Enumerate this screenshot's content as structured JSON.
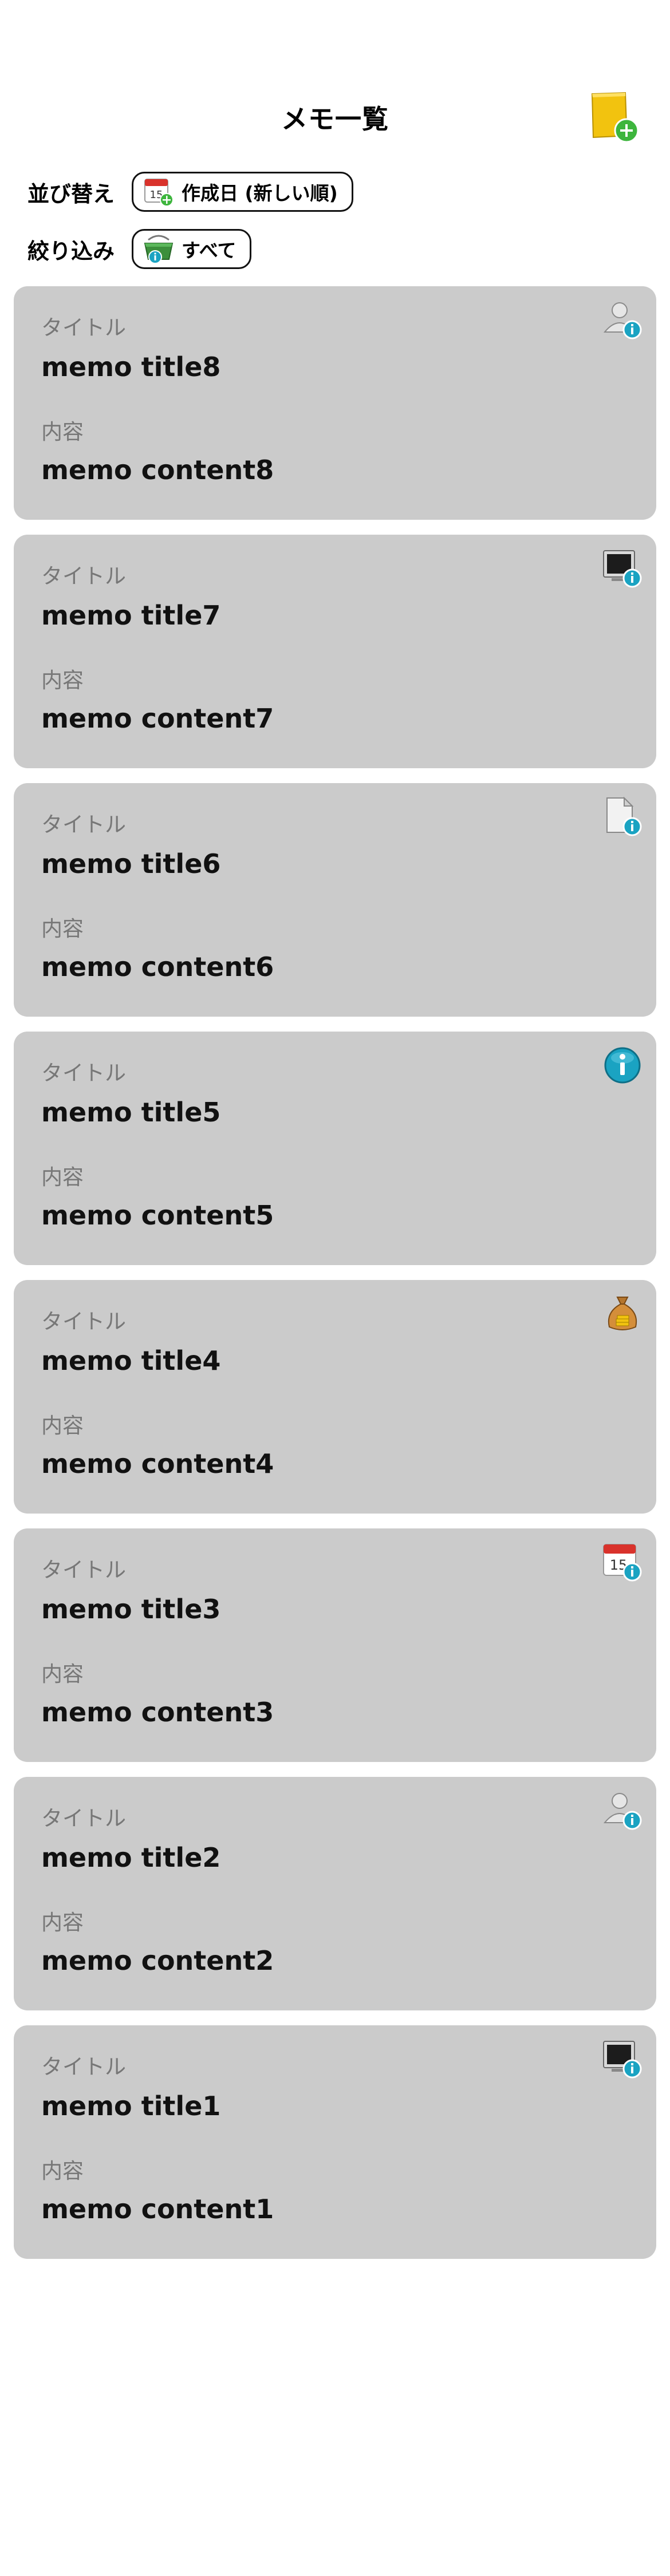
{
  "header": {
    "title": "メモ一覧",
    "add_button_icon": "memo-add-icon"
  },
  "controls": {
    "sort": {
      "label": "並び替え",
      "value": "作成日 (新しい順)",
      "icon": "calendar-add-icon"
    },
    "filter": {
      "label": "絞り込み",
      "value": "すべて",
      "icon": "basket-info-icon"
    }
  },
  "memo_labels": {
    "title_label": "タイトル",
    "content_label": "内容"
  },
  "memos": [
    {
      "title": "memo title8",
      "content": "memo content8",
      "icon": "person-info-icon"
    },
    {
      "title": "memo title7",
      "content": "memo content7",
      "icon": "monitor-info-icon"
    },
    {
      "title": "memo title6",
      "content": "memo content6",
      "icon": "document-info-icon"
    },
    {
      "title": "memo title5",
      "content": "memo content5",
      "icon": "info-icon"
    },
    {
      "title": "memo title4",
      "content": "memo content4",
      "icon": "money-bag-icon"
    },
    {
      "title": "memo title3",
      "content": "memo content3",
      "icon": "calendar-info-icon"
    },
    {
      "title": "memo title2",
      "content": "memo content2",
      "icon": "person-info-icon"
    },
    {
      "title": "memo title1",
      "content": "memo content1",
      "icon": "monitor-info-icon"
    }
  ],
  "colors": {
    "card_background": "#cbcbcb",
    "label_gray": "#777777",
    "info_badge": "#1aa3c2",
    "add_badge": "#3db53d",
    "memo_yellow": "#f2c30f"
  }
}
